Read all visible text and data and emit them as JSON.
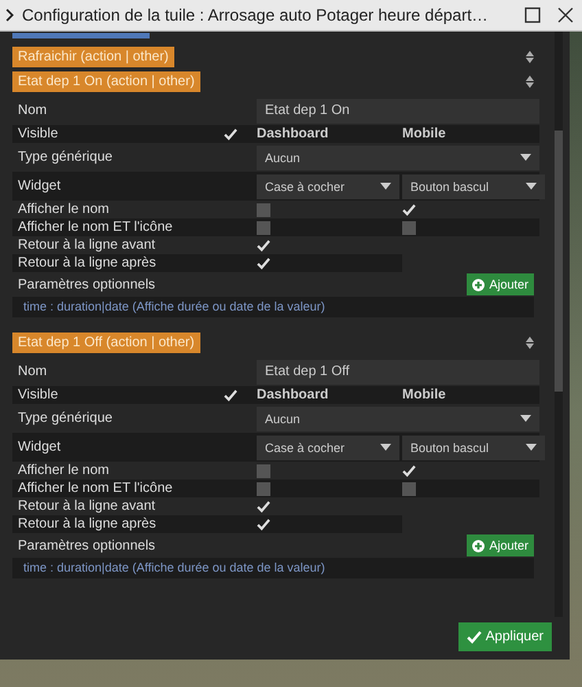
{
  "window": {
    "title": "Configuration de la tuile : Arrosage auto Potager heure départ…"
  },
  "commands": [
    {
      "kind": "info"
    },
    {
      "label": "Rafraichir (action | other)",
      "kind": "action"
    },
    {
      "label": "Etat dep 1 On (action | other)",
      "kind": "action",
      "config": {
        "name_label": "Nom",
        "name_value": "Etat dep 1 On",
        "visible_label": "Visible",
        "visible": true,
        "col_dashboard": "Dashboard",
        "col_mobile": "Mobile",
        "type_label": "Type générique",
        "type_value": "Aucun",
        "widget_label": "Widget",
        "widget_dashboard": "Case à cocher",
        "widget_mobile": "Bouton bascul",
        "options": [
          {
            "label": "Afficher le nom",
            "dashboard": false,
            "mobile": true
          },
          {
            "label": "Afficher le nom ET l'icône",
            "dashboard": false,
            "mobile": false
          },
          {
            "label": "Retour à la ligne avant",
            "dashboard": true
          },
          {
            "label": "Retour à la ligne après",
            "dashboard": true
          }
        ],
        "params_label": "Paramètres optionnels",
        "add_button": "Ajouter",
        "param_hint": "time : duration|date (Affiche durée ou date de la valeur)"
      }
    },
    {
      "label": "Etat dep 1 Off (action | other)",
      "kind": "action",
      "config": {
        "name_label": "Nom",
        "name_value": "Etat dep 1 Off",
        "visible_label": "Visible",
        "visible": true,
        "col_dashboard": "Dashboard",
        "col_mobile": "Mobile",
        "type_label": "Type générique",
        "type_value": "Aucun",
        "widget_label": "Widget",
        "widget_dashboard": "Case à cocher",
        "widget_mobile": "Bouton bascul",
        "options": [
          {
            "label": "Afficher le nom",
            "dashboard": false,
            "mobile": true
          },
          {
            "label": "Afficher le nom ET l'icône",
            "dashboard": false,
            "mobile": false
          },
          {
            "label": "Retour à la ligne avant",
            "dashboard": true
          },
          {
            "label": "Retour à la ligne après",
            "dashboard": true
          }
        ],
        "params_label": "Paramètres optionnels",
        "add_button": "Ajouter",
        "param_hint": "time : duration|date (Affiche durée ou date de la valeur)"
      }
    }
  ],
  "apply_button": "Appliquer"
}
